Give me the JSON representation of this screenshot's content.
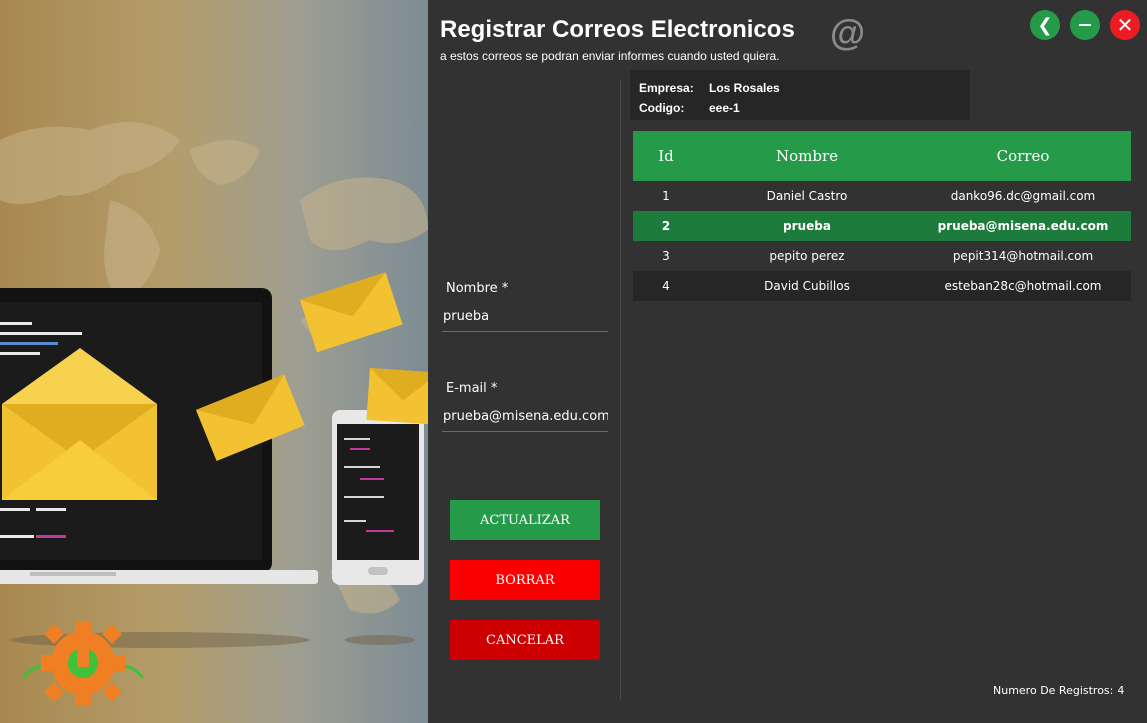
{
  "header": {
    "title": "Registrar Correos Electronicos",
    "subtitle": "a estos correos se podran enviar informes cuando usted quiera.",
    "at_symbol": "@"
  },
  "window_controls": {
    "back_glyph": "❮",
    "close_glyph": "✕",
    "icons": [
      "back-arrow-icon",
      "minimize-icon",
      "close-icon"
    ]
  },
  "company": {
    "empresa_label": "Empresa:",
    "empresa_value": "Los Rosales",
    "codigo_label": "Codigo:",
    "codigo_value": "eee-1"
  },
  "form": {
    "nombre_label": "Nombre  *",
    "nombre_value": "prueba",
    "email_label": "E-mail *",
    "email_value": "prueba@misena.edu.com"
  },
  "buttons": {
    "update": "ACTUALIZAR",
    "delete": "BORRAR",
    "cancel": "CANCELAR"
  },
  "table": {
    "columns": [
      "Id",
      "Nombre",
      "Correo"
    ],
    "rows": [
      {
        "id": "1",
        "nombre": "Daniel Castro",
        "correo": "danko96.dc@gmail.com"
      },
      {
        "id": "2",
        "nombre": "prueba",
        "correo": "prueba@misena.edu.com"
      },
      {
        "id": "3",
        "nombre": "pepito perez",
        "correo": "pepit314@hotmail.com"
      },
      {
        "id": "4",
        "nombre": "David Cubillos",
        "correo": "esteban28c@hotmail.com"
      }
    ],
    "selected_row": 1
  },
  "footer": {
    "count_label": "Numero De Registros:",
    "count_value": "4"
  },
  "colors": {
    "accent_green": "#259b4a",
    "selected_green": "#1d7c3b",
    "danger_red": "#fb0000",
    "cancel_red": "#cc0000",
    "panel_bg": "#323232"
  }
}
